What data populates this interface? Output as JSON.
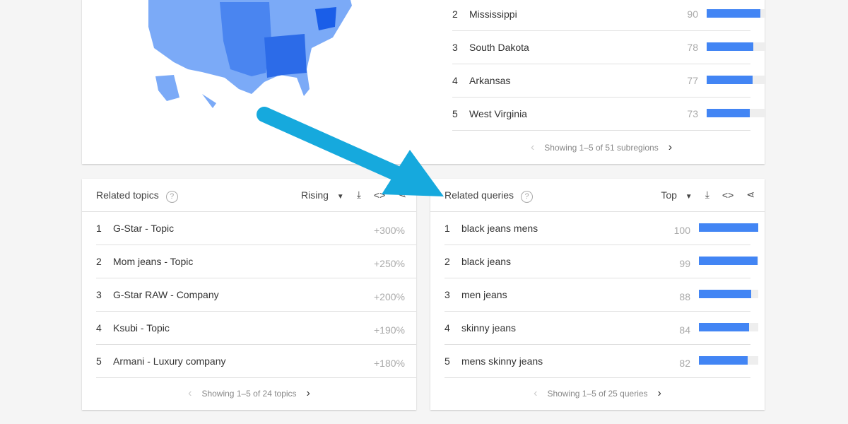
{
  "subregions": {
    "rows": [
      {
        "rank": "2",
        "name": "Mississippi",
        "value": 90
      },
      {
        "rank": "3",
        "name": "South Dakota",
        "value": 78
      },
      {
        "rank": "4",
        "name": "Arkansas",
        "value": 77
      },
      {
        "rank": "5",
        "name": "West Virginia",
        "value": 73
      }
    ],
    "footer": "Showing 1–5 of 51 subregions"
  },
  "topics": {
    "title": "Related topics",
    "filter": "Rising",
    "rows": [
      {
        "rank": "1",
        "name": "G-Star - Topic",
        "value": "+300%"
      },
      {
        "rank": "2",
        "name": "Mom jeans - Topic",
        "value": "+250%"
      },
      {
        "rank": "3",
        "name": "G-Star RAW - Company",
        "value": "+200%"
      },
      {
        "rank": "4",
        "name": "Ksubi - Topic",
        "value": "+190%"
      },
      {
        "rank": "5",
        "name": "Armani - Luxury company",
        "value": "+180%"
      }
    ],
    "footer": "Showing 1–5 of 24 topics"
  },
  "queries": {
    "title": "Related queries",
    "filter": "Top",
    "rows": [
      {
        "rank": "1",
        "name": "black jeans mens",
        "value": 100
      },
      {
        "rank": "2",
        "name": "black jeans",
        "value": 99
      },
      {
        "rank": "3",
        "name": "men jeans",
        "value": 88
      },
      {
        "rank": "4",
        "name": "skinny jeans",
        "value": 84
      },
      {
        "rank": "5",
        "name": "mens skinny jeans",
        "value": 82
      }
    ],
    "footer": "Showing 1–5 of 25 queries"
  },
  "colors": {
    "bar": "#4285f4",
    "arrow": "#16a9dd",
    "map_light": "#7baaf7",
    "map_dark": "#1a5ee8"
  }
}
